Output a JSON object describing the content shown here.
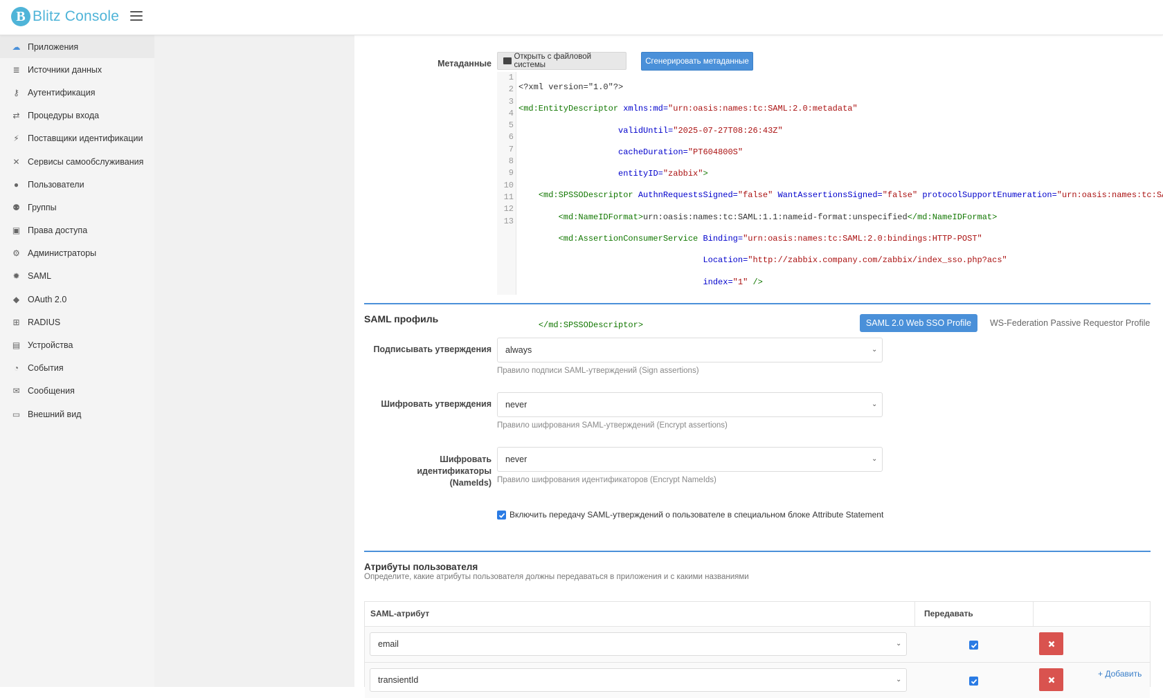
{
  "header": {
    "app_title": "Blitz Console"
  },
  "sidebar": {
    "items": [
      {
        "label": "Приложения",
        "icon": "cloud-icon"
      },
      {
        "label": "Источники данных",
        "icon": "database-icon"
      },
      {
        "label": "Аутентификация",
        "icon": "auth-icon"
      },
      {
        "label": "Процедуры входа",
        "icon": "login-procedure-icon"
      },
      {
        "label": "Поставщики идентификации",
        "icon": "plug-icon"
      },
      {
        "label": "Сервисы самообслуживания",
        "icon": "tools-icon"
      },
      {
        "label": "Пользователи",
        "icon": "user-icon"
      },
      {
        "label": "Группы",
        "icon": "users-icon"
      },
      {
        "label": "Права доступа",
        "icon": "lock-icon"
      },
      {
        "label": "Администраторы",
        "icon": "gears-icon"
      },
      {
        "label": "SAML",
        "icon": "badge-icon"
      },
      {
        "label": "OAuth 2.0",
        "icon": "tag-icon"
      },
      {
        "label": "RADIUS",
        "icon": "radius-icon"
      },
      {
        "label": "Устройства",
        "icon": "device-icon"
      },
      {
        "label": "События",
        "icon": "events-icon"
      },
      {
        "label": "Сообщения",
        "icon": "envelope-icon"
      },
      {
        "label": "Внешний вид",
        "icon": "monitor-icon"
      }
    ]
  },
  "metadata": {
    "label": "Метаданные",
    "open_file_button": "Открыть с файловой системы",
    "generate_button": "Сгенерировать метаданные",
    "line_numbers": [
      "1",
      "2",
      "3",
      "4",
      "5",
      "6",
      "7",
      "8",
      "9",
      "10",
      "11",
      "12",
      "13"
    ]
  },
  "saml_profile": {
    "title": "SAML профиль",
    "tab_active": "SAML 2.0 Web SSO Profile",
    "tab_other": "WS-Federation Passive Requestor Profile",
    "sign_assertions": {
      "label": "Подписывать утверждения",
      "value": "always",
      "help": "Правило подписи SAML-утверждений (Sign assertions)"
    },
    "encrypt_assertions": {
      "label": "Шифровать утверждения",
      "value": "never",
      "help": "Правило шифрования SAML-утверждений (Encrypt assertions)"
    },
    "encrypt_nameids": {
      "label_line1": "Шифровать идентификаторы",
      "label_line2": "(NameIds)",
      "value": "never",
      "help": "Правило шифрования идентификаторов (Encrypt NameIds)"
    },
    "attribute_statement_checkbox": "Включить передачу SAML-утверждений о пользователе в специальном блоке Attribute Statement"
  },
  "user_attributes": {
    "title": "Атрибуты пользователя",
    "subtitle": "Определите, какие атрибуты пользователя должны передаваться в приложения и с какими названиями",
    "col_attribute": "SAML-атрибут",
    "col_transfer": "Передавать",
    "rows": [
      {
        "attribute": "email"
      },
      {
        "attribute": "transientId"
      }
    ],
    "add_link": "+ Добавить"
  },
  "colors": {
    "accent": "#4a90d9",
    "danger": "#d9534f",
    "logo": "#4fb4d8"
  }
}
